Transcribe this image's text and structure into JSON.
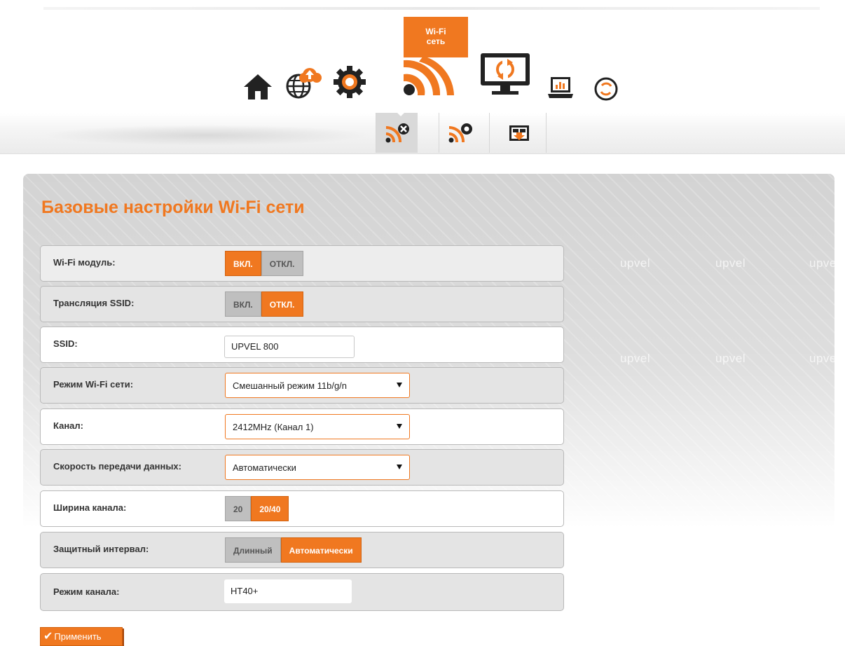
{
  "header": {
    "active_tooltip": {
      "title": "Wi-Fi",
      "subtitle": "сеть"
    },
    "nav_icons": [
      {
        "icon": "home-icon"
      },
      {
        "icon": "globe-cloud-icon"
      },
      {
        "icon": "gear-icon"
      },
      {
        "icon": "wifi-icon",
        "active": true
      },
      {
        "icon": "monitor-refresh-icon"
      },
      {
        "icon": "laptop-chart-icon"
      },
      {
        "icon": "power-icon"
      }
    ]
  },
  "subnav": {
    "items": [
      {
        "icon": "wifi-settings-icon",
        "active": true
      },
      {
        "icon": "wifi-security-icon",
        "active": false
      },
      {
        "icon": "wps-icon",
        "active": false
      }
    ]
  },
  "panel": {
    "title": "Базовые настройки Wi-Fi сети",
    "watermark": "upvel"
  },
  "form": {
    "wifi_module": {
      "label": "Wi-Fi модуль:",
      "on": "ВКЛ.",
      "off": "ОТКЛ.",
      "selected": "on"
    },
    "ssid_broadcast": {
      "label": "Трансляция SSID:",
      "on": "ВКЛ.",
      "off": "ОТКЛ.",
      "selected": "off"
    },
    "ssid": {
      "label": "SSID:",
      "value": "UPVEL 800"
    },
    "wifi_mode": {
      "label": "Режим Wi-Fi сети:",
      "value": "Смешанный режим 11b/g/n"
    },
    "channel": {
      "label": "Канал:",
      "value": "2412MHz (Канал 1)"
    },
    "data_rate": {
      "label": "Скорость передачи данных:",
      "value": "Автоматически"
    },
    "channel_width": {
      "label": "Ширина канала:",
      "opt1": "20",
      "opt2": "20/40",
      "selected": "20/40"
    },
    "guard_interval": {
      "label": "Защитный интервал:",
      "opt1": "Длинный",
      "opt2": "Автоматически",
      "selected": "Автоматически"
    },
    "channel_mode": {
      "label": "Режим канала:",
      "value": "HT40+"
    }
  },
  "actions": {
    "apply_label": "Применить"
  },
  "colors": {
    "accent": "#f07820",
    "icon_dark": "#222222"
  }
}
